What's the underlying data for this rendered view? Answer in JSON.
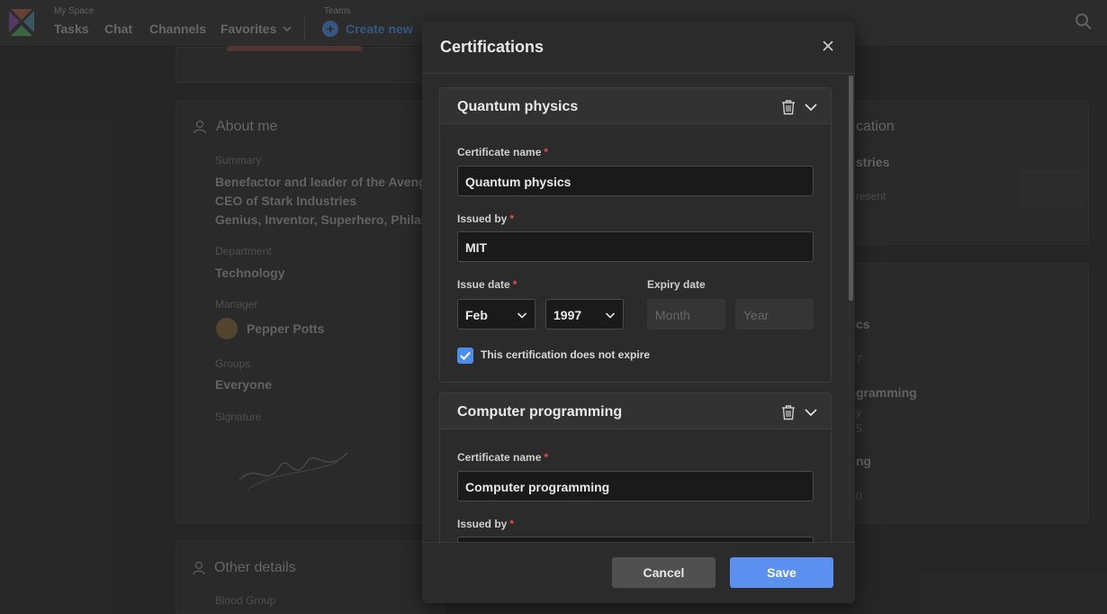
{
  "topbar": {
    "space_label": "My Space",
    "nav": [
      "Tasks",
      "Chat",
      "Channels",
      "Favorites"
    ],
    "teams_label": "Teams",
    "create_new": "Create new"
  },
  "about": {
    "title": "About me",
    "summary_label": "Summary",
    "summary_lines": [
      "Benefactor and leader of the Aveng",
      "CEO of Stark Industries",
      "Genius, Inventor, Superhero, Philant"
    ],
    "department_label": "Department",
    "department": "Technology",
    "manager_label": "Manager",
    "manager": "Pepper Potts",
    "groups_label": "Groups",
    "groups": "Everyone",
    "signature_label": "Signature"
  },
  "other": {
    "title": "Other details",
    "blood_label": "Blood Group"
  },
  "right_bg": {
    "title": "cation",
    "line1": "stries",
    "line2": "resent",
    "line3": "cs",
    "line4": "7",
    "line5": "gramming",
    "line6": "y",
    "line7": "5",
    "line8": "ng",
    "line9": "0"
  },
  "modal": {
    "title": "Certifications",
    "sections": [
      {
        "title": "Quantum physics",
        "cert_name_label": "Certificate name",
        "cert_name": "Quantum physics",
        "issued_by_label": "Issued by",
        "issued_by": "MIT",
        "issue_date_label": "Issue date",
        "issue_month": "Feb",
        "issue_year": "1997",
        "expiry_label": "Expiry date",
        "expiry_month_placeholder": "Month",
        "expiry_year_placeholder": "Year",
        "no_expire_label": "This certification does not expire"
      },
      {
        "title": "Computer programming",
        "cert_name_label": "Certificate name",
        "cert_name": "Computer programming",
        "issued_by_label": "Issued by"
      }
    ],
    "required_mark": "*",
    "cancel": "Cancel",
    "save": "Save"
  },
  "colors": {
    "accent": "#5b8ff0",
    "required": "#e0504a",
    "checkbox": "#4f8de8"
  }
}
